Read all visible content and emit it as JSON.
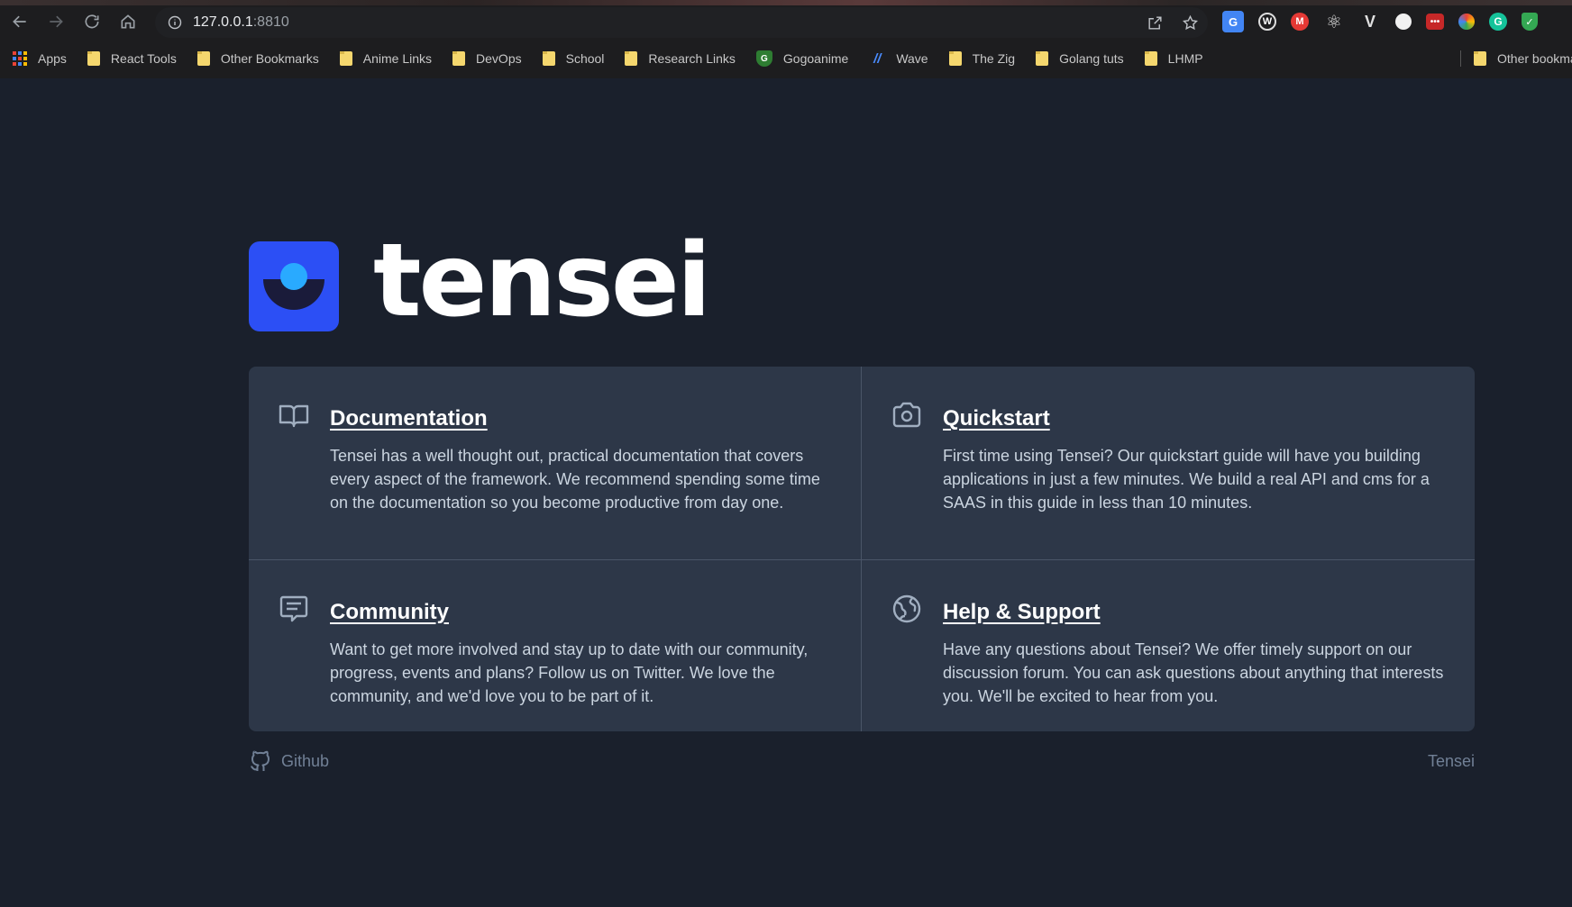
{
  "browser": {
    "url_host": "127.0.0.1",
    "url_port": ":8810",
    "extensions": [
      {
        "name": "translate-extension",
        "glyph": "G",
        "color": "#4285f4"
      },
      {
        "name": "w-extension",
        "glyph": "W",
        "color": "#3a3a3a"
      },
      {
        "name": "m-extension",
        "glyph": "M",
        "color": "#e53935"
      },
      {
        "name": "react-devtools-extension",
        "glyph": "⚛",
        "color": "#1d1d1f"
      },
      {
        "name": "v-extension",
        "glyph": "V",
        "color": "#1d1d1f"
      },
      {
        "name": "circle-extension",
        "glyph": "●",
        "color": "#1d1d1f"
      },
      {
        "name": "red-extension",
        "glyph": "▣",
        "color": "#c62828"
      },
      {
        "name": "color-extension",
        "glyph": "◆",
        "color": "#1d1d1f"
      },
      {
        "name": "grammarly-extension",
        "glyph": "G",
        "color": "#15c39a"
      },
      {
        "name": "shield-extension",
        "glyph": "✓",
        "color": "#34a853"
      }
    ],
    "bookmarks": {
      "apps": "Apps",
      "items": [
        "React Tools",
        "Other Bookmarks",
        "Anime Links",
        "DevOps",
        "School",
        "Research Links",
        "Gogoanime",
        "Wave",
        "The Zig",
        "Golang tuts",
        "LHMP"
      ],
      "other": "Other bookma"
    }
  },
  "logo": {
    "text": "tensei"
  },
  "cards": [
    {
      "title": "Documentation",
      "text": "Tensei has a well thought out, practical documentation that covers every aspect of the framework. We recommend spending some time on the documentation so you become productive from day one."
    },
    {
      "title": "Quickstart",
      "text": "First time using Tensei? Our quickstart guide will have you building applications in just a few minutes. We build a real API and cms for a SAAS in this guide in less than 10 minutes."
    },
    {
      "title": "Community",
      "text": "Want to get more involved and stay up to date with our community, progress, events and plans? Follow us on Twitter. We love the community, and we'd love you to be part of it."
    },
    {
      "title": "Help & Support",
      "text": "Have any questions about Tensei? We offer timely support on our discussion forum. You can ask questions about anything that interests you. We'll be excited to hear from you."
    }
  ],
  "footer": {
    "github": "Github",
    "brand": "Tensei"
  }
}
